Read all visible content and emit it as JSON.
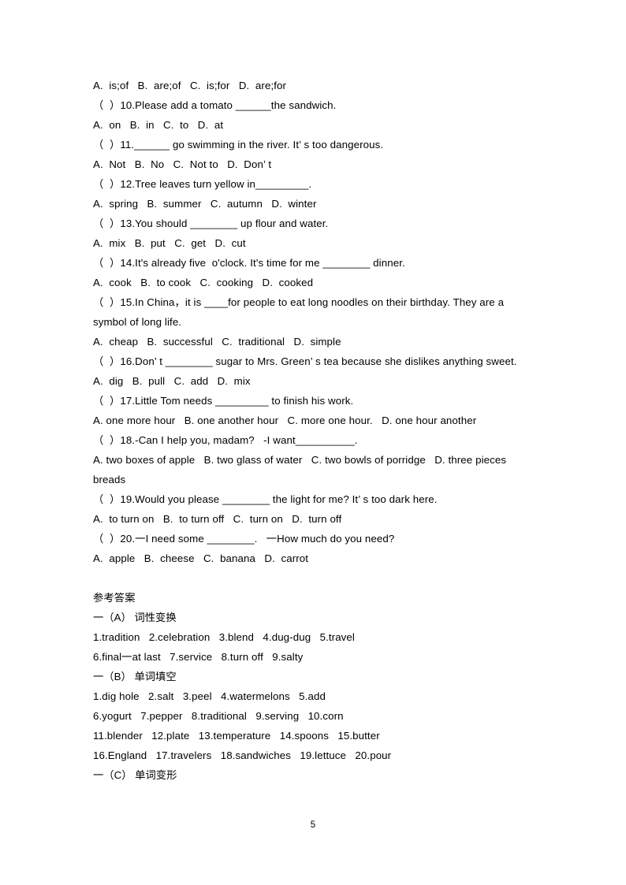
{
  "document": {
    "page_number": "5",
    "question_lines": [
      "A.  is;of   B.  are;of   C.  is;for   D.  are;for",
      "（  ）10.Please add a tomato ______the sandwich.",
      "A.  on   B.  in   C.  to   D.  at",
      "（  ）11.______ go swimming in the river. It’ s too dangerous.",
      "A.  Not   B.  No   C.  Not to   D.  Don’ t",
      "（  ）12.Tree leaves turn yellow in_________.",
      "A.  spring   B.  summer   C.  autumn   D.  winter",
      "（  ）13.You should ________ up flour and water.",
      "A.  mix   B.  put   C.  get   D.  cut",
      "（  ）14.It's already five  o'clock. It's time for me ________ dinner.",
      "A.  cook   B.  to cook   C.  cooking   D.  cooked",
      "（  ）15.In China，it is ____for people to eat long noodles on their birthday. They are a symbol of long life.",
      "A.  cheap   B.  successful   C.  traditional   D.  simple",
      "（  ）16.Don’ t ________ sugar to Mrs. Green’ s tea because she dislikes anything sweet.",
      "A.  dig   B.  pull   C.  add   D.  mix",
      "（  ）17.Little Tom needs _________ to finish his work.",
      "A. one more hour   B. one another hour   C. more one hour.   D. one hour another",
      "（  ）18.-Can I help you, madam?   -I want__________.",
      "A. two boxes of apple   B. two glass of water   C. two bowls of porridge   D. three pieces breads",
      "（  ）19.Would you please ________ the light for me? It’ s too dark here.",
      "A.  to turn on   B.  to turn off   C.  turn on   D.  turn off",
      "（  ）20.一I need some ________.   一How much do you need?",
      "A.  apple   B.  cheese   C.  banana   D.  carrot"
    ],
    "answer_key": {
      "title": "参考答案",
      "sections": [
        {
          "heading": "一（A） 词性变换",
          "lines": [
            "1.tradition   2.celebration   3.blend   4.dug-dug   5.travel",
            "6.final一at last   7.service   8.turn off   9.salty"
          ]
        },
        {
          "heading": "一（B） 单词填空",
          "lines": [
            "1.dig hole   2.salt   3.peel   4.watermelons   5.add",
            "6.yogurt   7.pepper   8.traditional   9.serving   10.corn",
            "11.blender   12.plate   13.temperature   14.spoons   15.butter",
            "16.England   17.travelers   18.sandwiches   19.lettuce   20.pour"
          ]
        },
        {
          "heading": "一（C） 单词变形",
          "lines": []
        }
      ]
    }
  }
}
